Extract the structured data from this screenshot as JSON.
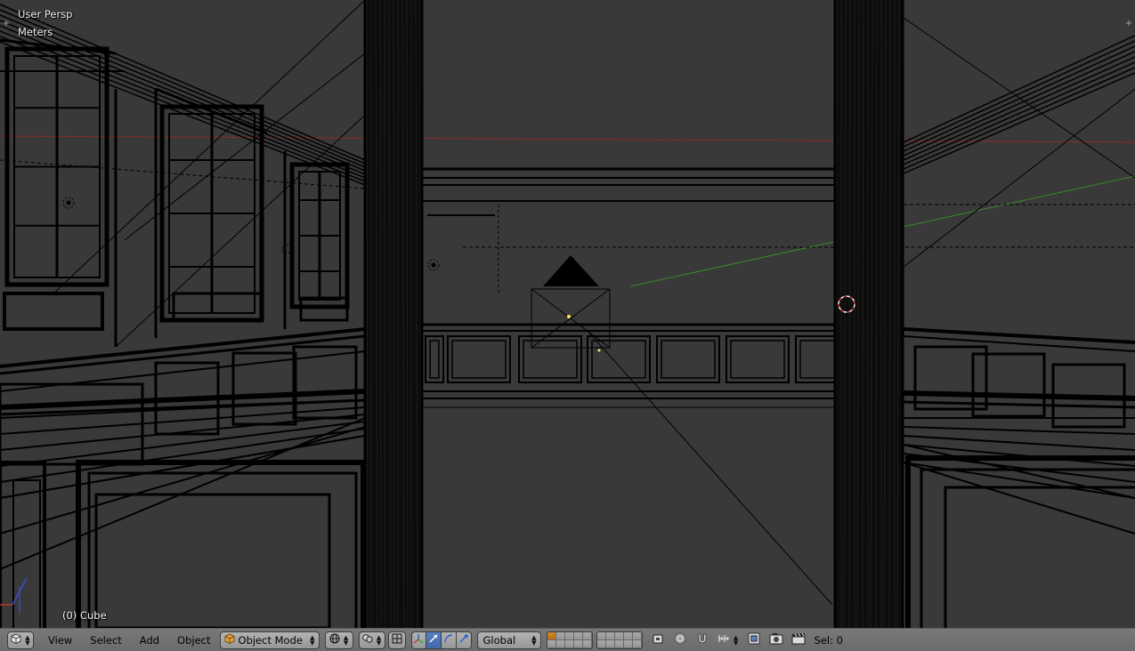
{
  "viewport": {
    "view_name": "User Persp",
    "units": "Meters",
    "active_object": "(0) Cube",
    "corner_glyph": "+",
    "colors": {
      "background": "#393939",
      "wire": "#000000",
      "x_axis": "#8a2a2a",
      "y_axis": "#3a8a2a"
    }
  },
  "header": {
    "editor_type_icon": "view3d-cube-icon",
    "menus": [
      "View",
      "Select",
      "Add",
      "Object"
    ],
    "mode": {
      "label": "Object Mode",
      "icon": "object-cube-icon"
    },
    "viewport_shading_icon": "wireframe-sphere-icon",
    "pivot_icon": "pivot-point-icon",
    "manipulator_icons": [
      "manipulator-toggle-icon",
      "translate-icon",
      "rotate-icon",
      "scale-icon"
    ],
    "orientation": "Global",
    "selection_status": "Sel: 0",
    "colors": {
      "header_bg": "#727272",
      "active_toggle": "#4a74b6",
      "active_layer": "#c97b20"
    }
  }
}
